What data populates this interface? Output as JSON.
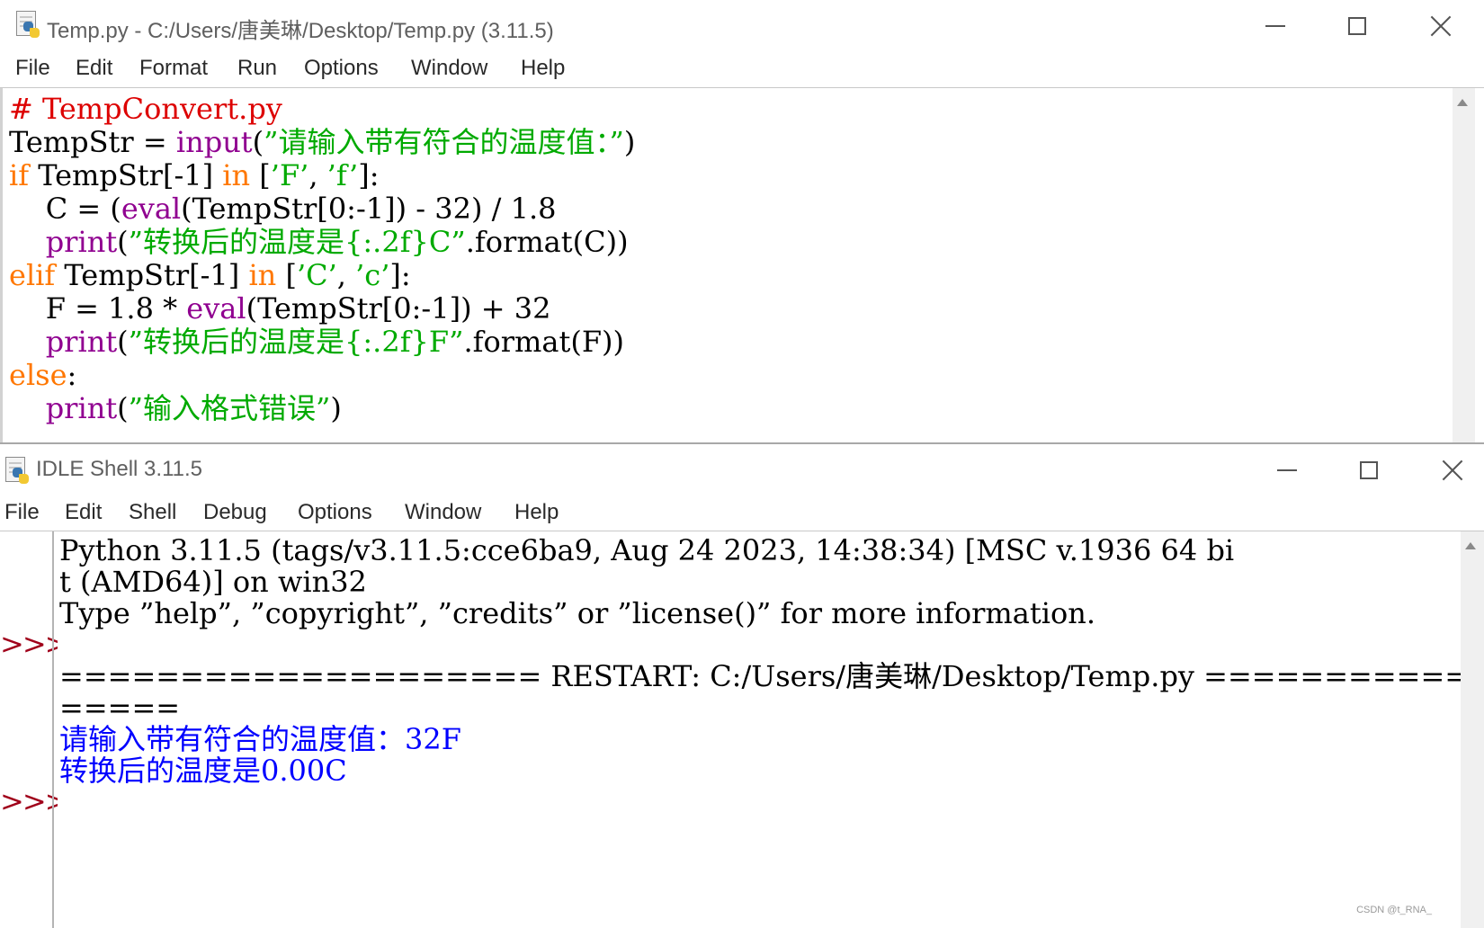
{
  "editor": {
    "title": "Temp.py - C:/Users/唐美琳/Desktop/Temp.py (3.11.5)",
    "menu": [
      "File",
      "Edit",
      "Format",
      "Run",
      "Options",
      "Window",
      "Help"
    ],
    "code_lines": [
      [
        {
          "t": "# TempConvert.py",
          "c": "comment"
        }
      ],
      [
        {
          "t": "TempStr = ",
          "c": "default"
        },
        {
          "t": "input",
          "c": "builtin"
        },
        {
          "t": "(",
          "c": "default"
        },
        {
          "t": "”请输入带有符合的温度值：”",
          "c": "string"
        },
        {
          "t": ")",
          "c": "default"
        }
      ],
      [
        {
          "t": "if",
          "c": "keyword"
        },
        {
          "t": " TempStr[-1] ",
          "c": "default"
        },
        {
          "t": "in",
          "c": "keyword"
        },
        {
          "t": " [",
          "c": "default"
        },
        {
          "t": "’F’",
          "c": "string"
        },
        {
          "t": ", ",
          "c": "default"
        },
        {
          "t": "’f’",
          "c": "string"
        },
        {
          "t": "]:",
          "c": "default"
        }
      ],
      [
        {
          "t": "    C = (",
          "c": "default"
        },
        {
          "t": "eval",
          "c": "builtin"
        },
        {
          "t": "(TempStr[0:-1]) - 32) / 1.8",
          "c": "default"
        }
      ],
      [
        {
          "t": "    ",
          "c": "default"
        },
        {
          "t": "print",
          "c": "builtin"
        },
        {
          "t": "(",
          "c": "default"
        },
        {
          "t": "”转换后的温度是{:.2f}C”",
          "c": "string"
        },
        {
          "t": ".format(C))",
          "c": "default"
        }
      ],
      [
        {
          "t": "elif",
          "c": "keyword"
        },
        {
          "t": " TempStr[-1] ",
          "c": "default"
        },
        {
          "t": "in",
          "c": "keyword"
        },
        {
          "t": " [",
          "c": "default"
        },
        {
          "t": "’C’",
          "c": "string"
        },
        {
          "t": ", ",
          "c": "default"
        },
        {
          "t": "’c’",
          "c": "string"
        },
        {
          "t": "]:",
          "c": "default"
        }
      ],
      [
        {
          "t": "    F = 1.8 * ",
          "c": "default"
        },
        {
          "t": "eval",
          "c": "builtin"
        },
        {
          "t": "(TempStr[0:-1]) + 32",
          "c": "default"
        }
      ],
      [
        {
          "t": "    ",
          "c": "default"
        },
        {
          "t": "print",
          "c": "builtin"
        },
        {
          "t": "(",
          "c": "default"
        },
        {
          "t": "”转换后的温度是{:.2f}F”",
          "c": "string"
        },
        {
          "t": ".format(F))",
          "c": "default"
        }
      ],
      [
        {
          "t": "else",
          "c": "keyword"
        },
        {
          "t": ":",
          "c": "default"
        }
      ],
      [
        {
          "t": "    ",
          "c": "default"
        },
        {
          "t": "print",
          "c": "builtin"
        },
        {
          "t": "(",
          "c": "default"
        },
        {
          "t": "”输入格式错误”",
          "c": "string"
        },
        {
          "t": ")",
          "c": "default"
        }
      ]
    ]
  },
  "shell": {
    "title": "IDLE Shell 3.11.5",
    "menu": [
      "File",
      "Edit",
      "Shell",
      "Debug",
      "Options",
      "Window",
      "Help"
    ],
    "prompt_symbol": ">>>",
    "lines": [
      {
        "t": "Python 3.11.5 (tags/v3.11.5:cce6ba9, Aug 24 2023, 14:38:34) [MSC v.1936 64 bi",
        "c": "default"
      },
      {
        "t": "t (AMD64)] on win32",
        "c": "default"
      },
      {
        "t": "Type ”help”, ”copyright”, ”credits” or ”license()” for more information.",
        "c": "default"
      },
      {
        "t": "",
        "c": "default"
      },
      {
        "t": "==================== RESTART: C:/Users/唐美琳/Desktop/Temp.py ===============",
        "c": "default"
      },
      {
        "t": "=====",
        "c": "default"
      },
      {
        "t": "请输入带有符合的温度值：32F",
        "c": "stdout"
      },
      {
        "t": "转换后的温度是0.00C",
        "c": "stdout"
      }
    ]
  },
  "watermark": "CSDN @t_RNA_",
  "colors": {
    "comment": "#dd0000",
    "keyword": "#ff7700",
    "builtin": "#900090",
    "string": "#00aa00",
    "stdout": "#0000ff",
    "prompt": "#a0001a"
  }
}
